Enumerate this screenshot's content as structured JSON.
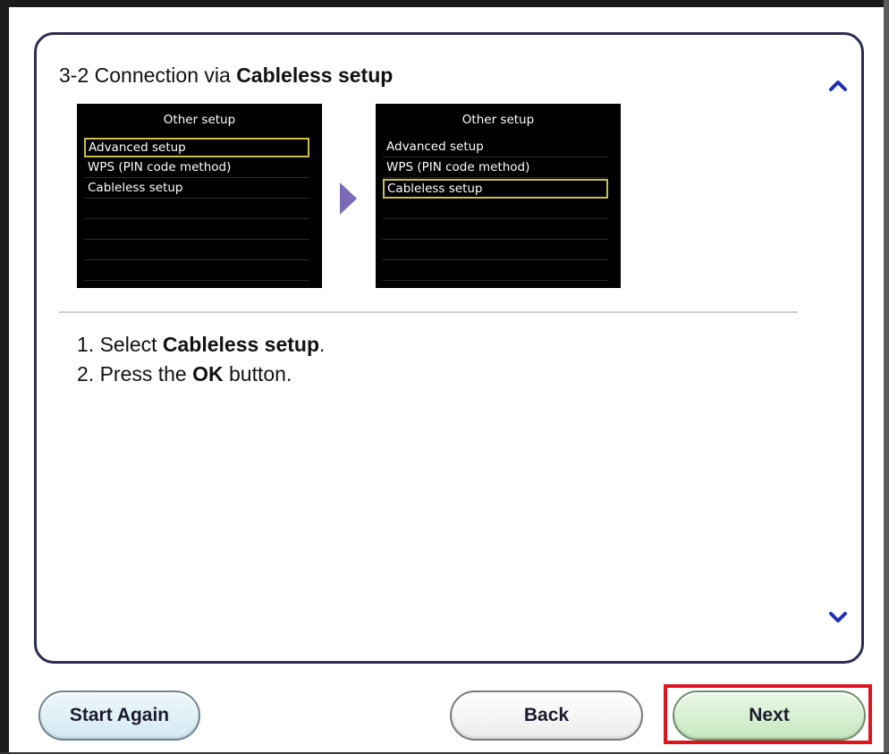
{
  "header": {
    "title_prefix": "3-2 Connection via ",
    "title_bold": "Cableless setup"
  },
  "screens": [
    {
      "title": "Other setup",
      "items": [
        "Advanced setup",
        "WPS (PIN code method)",
        "Cableless setup"
      ],
      "selected_index": 0
    },
    {
      "title": "Other setup",
      "items": [
        "Advanced setup",
        "WPS (PIN code method)",
        "Cableless setup"
      ],
      "selected_index": 2
    }
  ],
  "instructions": {
    "step1_prefix": "1. Select ",
    "step1_bold": "Cableless setup",
    "step1_suffix": ".",
    "step2_prefix": "2. Press the ",
    "step2_bold": "OK",
    "step2_suffix": " button."
  },
  "buttons": {
    "start_again": "Start Again",
    "back": "Back",
    "next": "Next"
  },
  "icons": {
    "scroll_up": "chevron-up-icon",
    "scroll_down": "chevron-down-icon",
    "step_arrow": "triangle-right-icon"
  },
  "colors": {
    "panel_border": "#2d2d52",
    "scroll_arrow": "#1f2fb8",
    "step_arrow": "#7a6ab8",
    "next_highlight": "#e0141c"
  }
}
